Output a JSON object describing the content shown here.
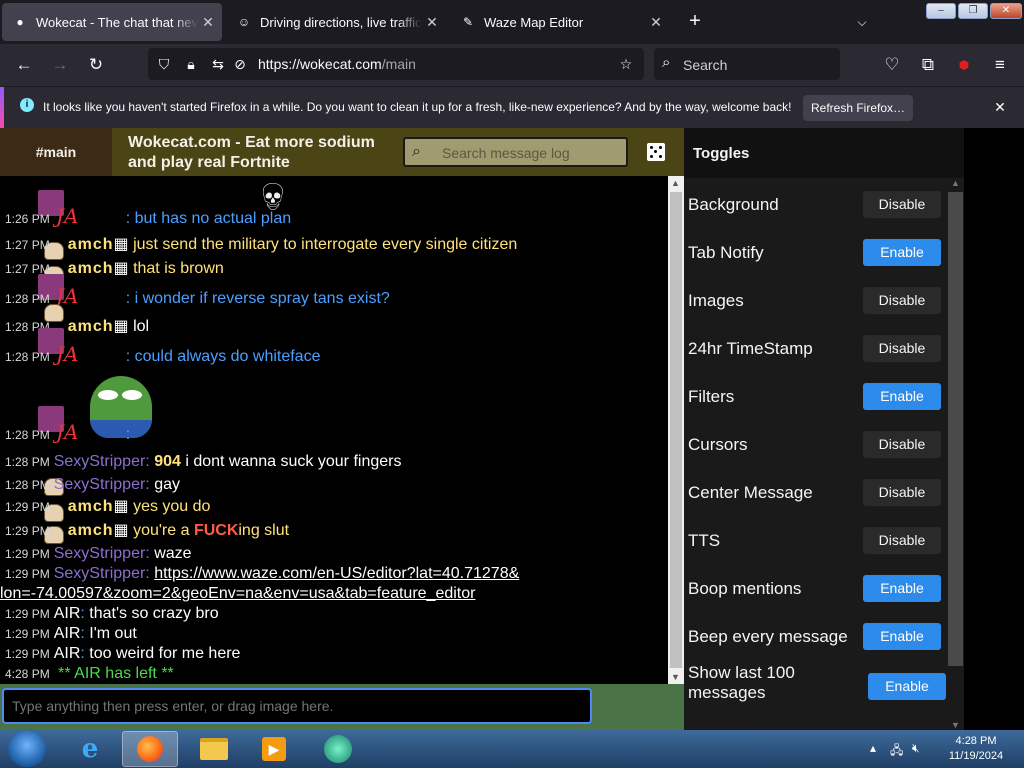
{
  "browser": {
    "tabs": [
      {
        "title": "Wokecat - The chat that never sleeps",
        "icon": "github-icon",
        "active": true
      },
      {
        "title": "Driving directions, live traffic & road conditions",
        "icon": "waze-icon",
        "active": false
      },
      {
        "title": "Waze Map Editor",
        "icon": "edit-icon",
        "active": false
      }
    ],
    "url_host": "https://wokecat.com",
    "url_path": "/main",
    "search_placeholder": "Search",
    "window_controls": {
      "minimize": "‒",
      "restore": "❐",
      "close": "✕"
    }
  },
  "notification": {
    "message": "It looks like you haven't started Firefox in a while. Do you want to clean it up for a fresh, like-new experience? And by the way, welcome back!",
    "button": "Refresh Firefox…"
  },
  "chat": {
    "room": "#main",
    "site_title": "Wokecat.com - Eat more sodium and play real Fortnite",
    "search_placeholder": "Search message log",
    "input_placeholder": "Type anything then press enter, or drag image here.",
    "messages": [
      {
        "time": "1:26 PM",
        "user": "JA",
        "text": ": but has no actual plan"
      },
      {
        "time": "1:27 PM",
        "user": "amch",
        "text": "just send the military to interrogate every single citizen"
      },
      {
        "time": "1:27 PM",
        "user": "amch",
        "text": "that is brown"
      },
      {
        "time": "1:28 PM",
        "user": "JA",
        "text": ": i wonder if reverse spray tans exist?"
      },
      {
        "time": "1:28 PM",
        "user": "amch",
        "text": "lol"
      },
      {
        "time": "1:28 PM",
        "user": "JA",
        "text": ": could always do whiteface"
      },
      {
        "time": "1:28 PM",
        "user": "JA",
        "text": ":"
      },
      {
        "time": "1:28 PM",
        "user": "SexyStripper",
        "badge": "904",
        "text": "i dont wanna suck your fingers"
      },
      {
        "time": "1:28 PM",
        "user": "SexyStripper",
        "text": "gay"
      },
      {
        "time": "1:29 PM",
        "user": "amch",
        "text": "yes you do"
      },
      {
        "time": "1:29 PM",
        "user": "amch",
        "text": "you're a",
        "highlight": "FUCK",
        "text_after": "ing slut"
      },
      {
        "time": "1:29 PM",
        "user": "SexyStripper",
        "text": "waze"
      },
      {
        "time": "1:29 PM",
        "user": "SexyStripper",
        "link_line1": "https://www.waze.com/en-US/editor?lat=40.71278&",
        "link_line2": "lon=-74.00597&zoom=2&geoEnv=na&env=usa&tab=feature_editor"
      },
      {
        "time": "1:29 PM",
        "user": "AIR",
        "text": "that's so crazy bro"
      },
      {
        "time": "1:29 PM",
        "user": "AIR",
        "text": "I'm out"
      },
      {
        "time": "1:29 PM",
        "user": "AIR",
        "text": "too weird for me here"
      },
      {
        "time": "4:28 PM",
        "user": "",
        "text": "** AIR has left **"
      }
    ]
  },
  "toggles": {
    "title": "Toggles",
    "items": [
      {
        "label": "Background",
        "button": "Disable",
        "state": "dis"
      },
      {
        "label": "Tab Notify",
        "button": "Enable",
        "state": "en"
      },
      {
        "label": "Images",
        "button": "Disable",
        "state": "dis"
      },
      {
        "label": "24hr TimeStamp",
        "button": "Disable",
        "state": "dis"
      },
      {
        "label": "Filters",
        "button": "Enable",
        "state": "en"
      },
      {
        "label": "Cursors",
        "button": "Disable",
        "state": "dis"
      },
      {
        "label": "Center Message",
        "button": "Disable",
        "state": "dis"
      },
      {
        "label": "TTS",
        "button": "Disable",
        "state": "dis"
      },
      {
        "label": "Boop mentions",
        "button": "Enable",
        "state": "en"
      },
      {
        "label": "Beep every message",
        "button": "Enable",
        "state": "en"
      },
      {
        "label": "Show last 100 messages",
        "button": "Enable",
        "state": "en"
      }
    ]
  },
  "taskbar": {
    "time": "4:28 PM",
    "date": "11/19/2024",
    "apps": [
      "internet-explorer-icon",
      "firefox-icon",
      "file-explorer-icon",
      "media-player-icon",
      "app-icon"
    ]
  },
  "colors": {
    "accent_enable": "#2d8ceb",
    "chat_header": "#4b4515",
    "input_bar": "#4a7448"
  }
}
